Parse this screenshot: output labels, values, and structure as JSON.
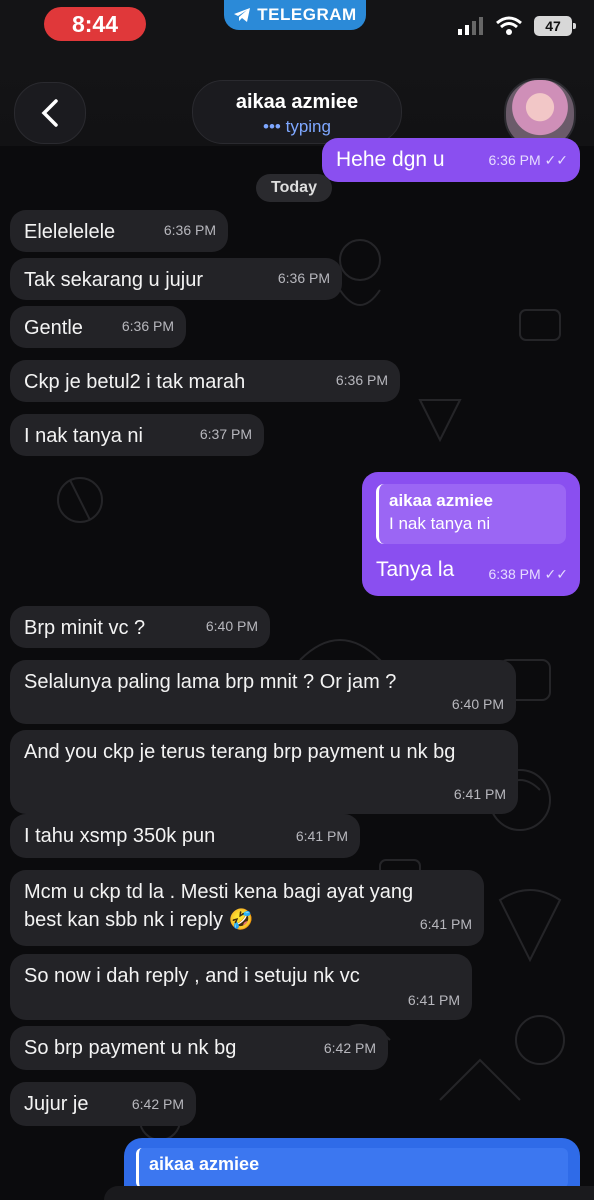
{
  "status_bar": {
    "time": "8:44",
    "app_pill": "TELEGRAM",
    "battery": "47"
  },
  "header": {
    "name": "aikaa azmiee",
    "status": "••• typing"
  },
  "date_label": "Today",
  "messages": [
    {
      "text": "Hehe dgn u",
      "time": "6:36 PM",
      "dir": "out"
    },
    {
      "text": "Elelelelele",
      "time": "6:36 PM",
      "dir": "in"
    },
    {
      "text": "Tak sekarang u jujur",
      "time": "6:36 PM",
      "dir": "in"
    },
    {
      "text": "Gentle",
      "time": "6:36 PM",
      "dir": "in"
    },
    {
      "text": "Ckp je betul2 i tak marah",
      "time": "6:36 PM",
      "dir": "in"
    },
    {
      "text": "I nak tanya ni",
      "time": "6:37 PM",
      "dir": "in"
    },
    {
      "reply_name": "aikaa azmiee",
      "reply_text": "I nak tanya ni",
      "text": "Tanya la",
      "time": "6:38 PM",
      "dir": "out"
    },
    {
      "text": "Brp minit vc ?",
      "time": "6:40 PM",
      "dir": "in"
    },
    {
      "text": "Selalunya paling lama brp mnit ? Or jam ?",
      "time": "6:40 PM",
      "dir": "in"
    },
    {
      "text": "And you ckp je terus terang brp payment u nk bg",
      "time": "6:41 PM",
      "dir": "in"
    },
    {
      "text": "I tahu xsmp 350k pun",
      "time": "6:41 PM",
      "dir": "in"
    },
    {
      "text": "Mcm u ckp td la . Mesti kena bagi ayat yang best kan sbb nk i reply 🤣",
      "time": "6:41 PM",
      "dir": "in"
    },
    {
      "text": "So now i dah reply , and i setuju nk vc",
      "time": "6:41 PM",
      "dir": "in"
    },
    {
      "text": "So brp payment u nk bg",
      "time": "6:42 PM",
      "dir": "in"
    },
    {
      "text": "Jujur je",
      "time": "6:42 PM",
      "dir": "in"
    }
  ],
  "compose": {
    "reply_name": "aikaa azmiee"
  },
  "colors": {
    "outgoing": "#8a4ff0",
    "incoming": "#232327",
    "accent": "#2f6be8",
    "time_pill": "#e0383a"
  }
}
